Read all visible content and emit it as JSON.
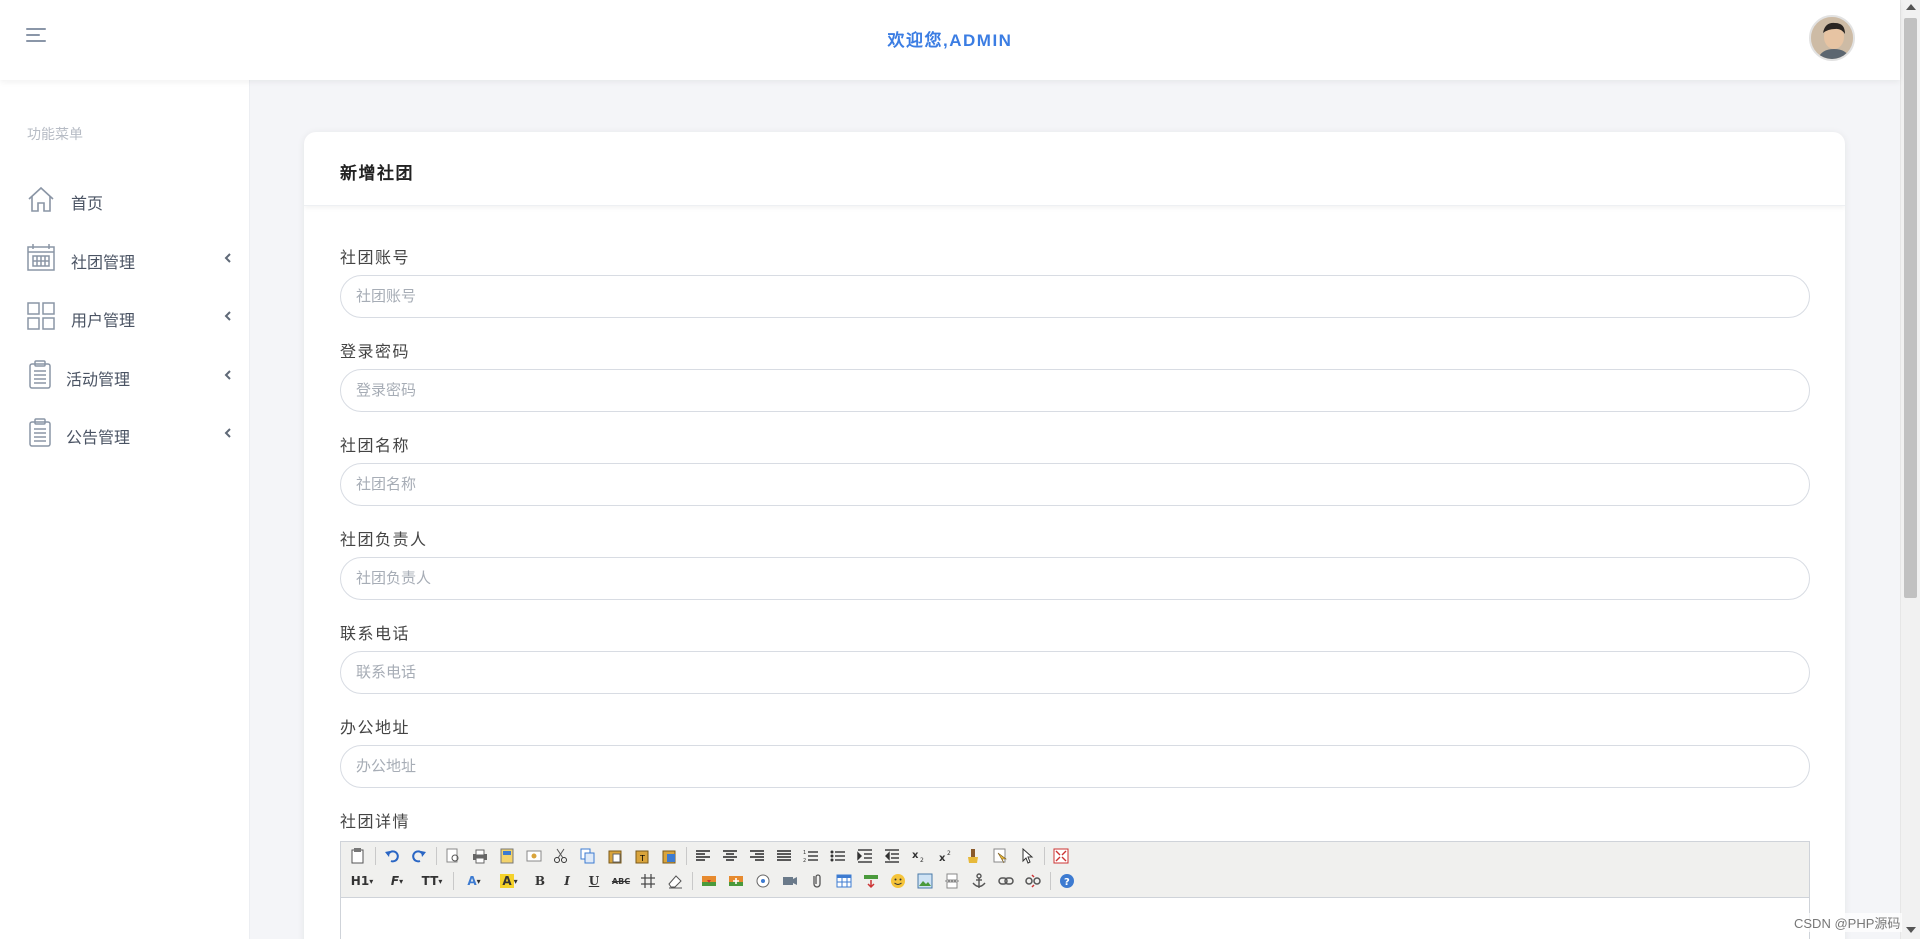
{
  "header": {
    "welcome": "欢迎您,ADMIN"
  },
  "sidebar": {
    "title": "功能菜单",
    "items": [
      {
        "label": "首页",
        "icon": "home-icon"
      },
      {
        "label": "社团管理",
        "icon": "calendar-icon"
      },
      {
        "label": "用户管理",
        "icon": "grid-icon"
      },
      {
        "label": "活动管理",
        "icon": "clipboard-icon"
      },
      {
        "label": "公告管理",
        "icon": "clipboard-icon"
      }
    ]
  },
  "form": {
    "title": "新增社团",
    "fields": [
      {
        "label": "社团账号",
        "placeholder": "社团账号",
        "value": ""
      },
      {
        "label": "登录密码",
        "placeholder": "登录密码",
        "value": ""
      },
      {
        "label": "社团名称",
        "placeholder": "社团名称",
        "value": ""
      },
      {
        "label": "社团负责人",
        "placeholder": "社团负责人",
        "value": ""
      },
      {
        "label": "联系电话",
        "placeholder": "联系电话",
        "value": ""
      },
      {
        "label": "办公地址",
        "placeholder": "办公地址",
        "value": ""
      }
    ],
    "editor_label": "社团详情",
    "toolbar_row2": {
      "heading": "H1",
      "font": "F",
      "size": "TT",
      "bold": "B",
      "italic": "I",
      "underline": "U",
      "strike": "ABC"
    }
  },
  "watermark": "CSDN @PHP源码"
}
